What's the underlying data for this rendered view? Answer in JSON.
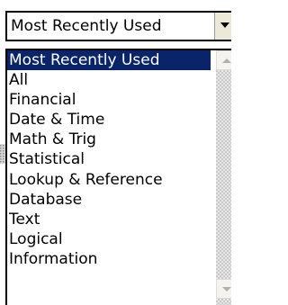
{
  "combo": {
    "value": "Most Recently Used",
    "dropdown_icon": "chevron-down-icon"
  },
  "list": {
    "items": [
      {
        "label": "Most Recently Used",
        "selected": true
      },
      {
        "label": "All",
        "selected": false
      },
      {
        "label": "Financial",
        "selected": false
      },
      {
        "label": "Date & Time",
        "selected": false
      },
      {
        "label": "Math & Trig",
        "selected": false
      },
      {
        "label": "Statistical",
        "selected": false
      },
      {
        "label": "Lookup & Reference",
        "selected": false
      },
      {
        "label": "Database",
        "selected": false
      },
      {
        "label": "Text",
        "selected": false
      },
      {
        "label": "Logical",
        "selected": false
      },
      {
        "label": "Information",
        "selected": false
      }
    ]
  },
  "scrollbar": {
    "up_icon": "scroll-up-arrow-icon",
    "down_icon": "scroll-down-arrow-icon"
  },
  "colors": {
    "selection_bg": "#0a246a",
    "selection_text": "#ffffff"
  }
}
